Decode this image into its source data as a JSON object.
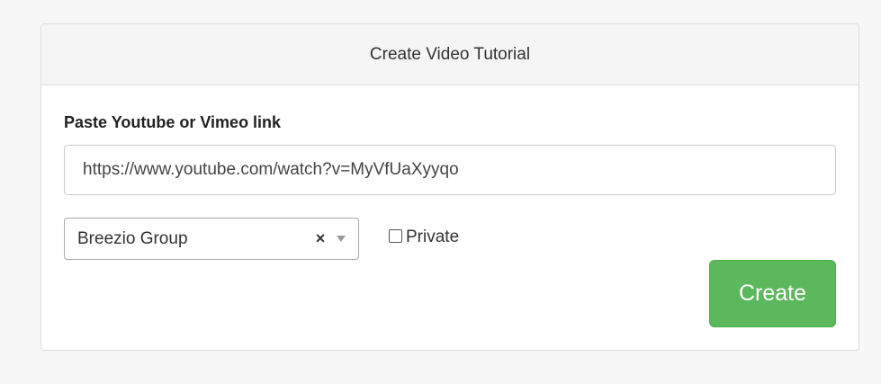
{
  "panel": {
    "title": "Create Video Tutorial"
  },
  "form": {
    "link_label": "Paste Youtube or Vimeo link",
    "link_value": "https://www.youtube.com/watch?v=MyVfUaXyyqo",
    "group_select": {
      "selected": "Breezio Group",
      "clear_symbol": "×"
    },
    "private_checkbox": {
      "label": "Private",
      "checked": false
    },
    "create_label": "Create"
  },
  "colors": {
    "create_button": "#5cb85c",
    "header_background": "#f5f5f5",
    "page_background": "#f7f7f7"
  },
  "icons": {
    "clear": "close-icon",
    "dropdown": "chevron-down-icon"
  }
}
